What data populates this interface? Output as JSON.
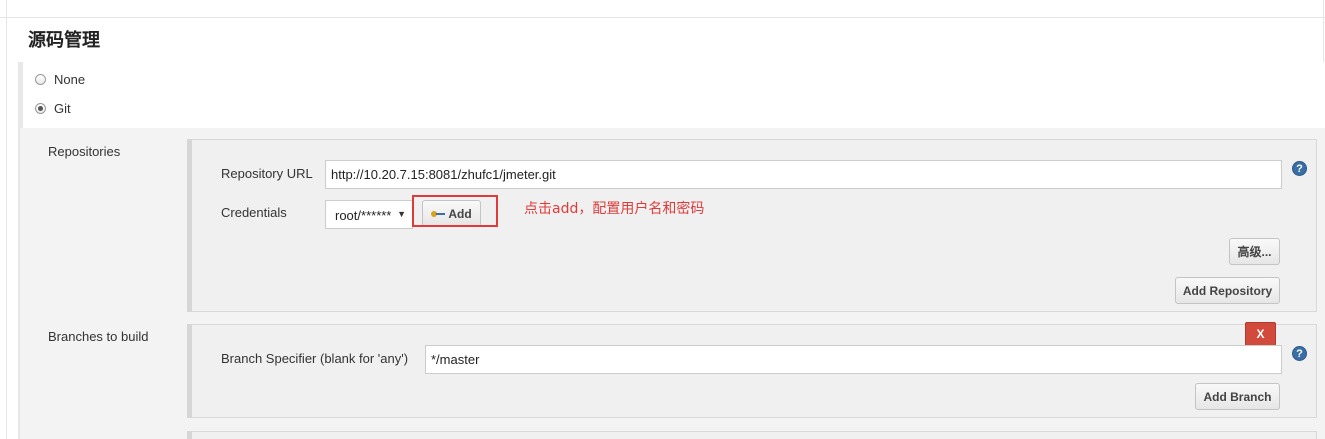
{
  "section_title": "源码管理",
  "scm_options": [
    {
      "label": "None",
      "checked": false
    },
    {
      "label": "Git",
      "checked": true
    }
  ],
  "repositories": {
    "label": "Repositories",
    "url_label": "Repository URL",
    "url_value": "http://10.20.7.15:8081/zhufc1/jmeter.git",
    "credentials_label": "Credentials",
    "credentials_value": "root/******",
    "add_button": "Add",
    "advanced_button": "高级...",
    "add_repository_button": "Add Repository"
  },
  "annotation": "点击add，配置用户名和密码",
  "branches": {
    "label": "Branches to build",
    "delete_button": "X",
    "specifier_label": "Branch Specifier (blank for 'any')",
    "specifier_value": "*/master",
    "add_branch_button": "Add Branch"
  },
  "help_glyph": "?",
  "colors": {
    "annotation": "#e03b3b",
    "delete": "#d24a3c",
    "help": "#3a6ea5"
  }
}
